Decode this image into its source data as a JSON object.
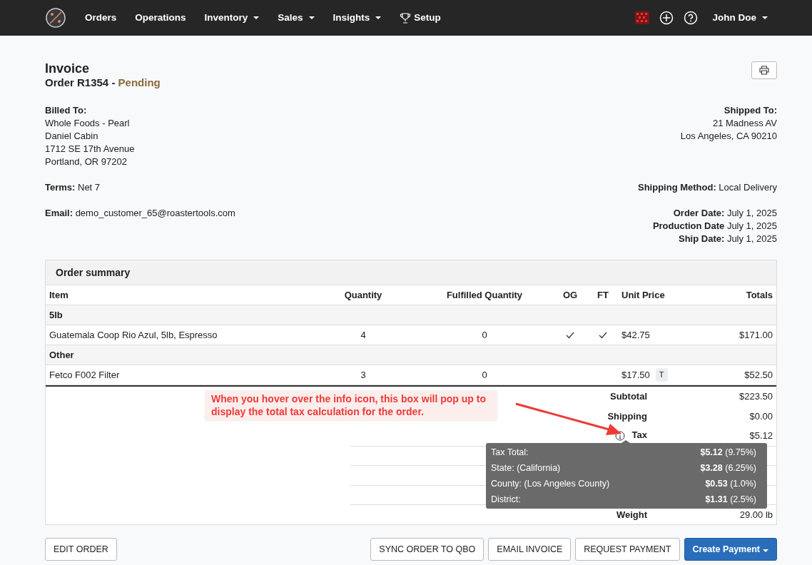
{
  "nav": {
    "items": [
      {
        "label": "Orders",
        "dropdown": false,
        "kind": "link"
      },
      {
        "label": "Operations",
        "dropdown": false,
        "kind": "link"
      },
      {
        "label": "Inventory",
        "dropdown": true,
        "kind": "link"
      },
      {
        "label": "Sales",
        "dropdown": true,
        "kind": "link"
      },
      {
        "label": "Insights",
        "dropdown": true,
        "kind": "link"
      },
      {
        "label": "Setup",
        "dropdown": false,
        "kind": "icon-link"
      }
    ],
    "user": {
      "label": "John Doe",
      "dropdown": true
    }
  },
  "invoice": {
    "title": "Invoice",
    "order": "Order R1354 - ",
    "status": "Pending"
  },
  "billed_to": {
    "heading": "Billed To:",
    "lines": [
      "Whole Foods - Pearl",
      "Daniel Cabin",
      "1712 SE 17th Avenue",
      "Portland, OR 97202"
    ]
  },
  "shipped_to": {
    "heading": "Shipped To:",
    "lines": [
      "21 Madness AV",
      "Los Angeles, CA 90210"
    ]
  },
  "terms": {
    "label": "Terms:",
    "value": "Net 7"
  },
  "shipping_method": {
    "label": "Shipping Method:",
    "value": "Local Delivery"
  },
  "email": {
    "label": "Email:",
    "value": "demo_customer_65@roastertools.com"
  },
  "dates": [
    {
      "label": "Order Date:",
      "value": "July 1, 2025"
    },
    {
      "label": "Production Date",
      "value": "July 1, 2025"
    },
    {
      "label": "Ship Date:",
      "value": "July 1, 2025"
    }
  ],
  "summary": {
    "title": "Order summary",
    "columns": [
      "Item",
      "Quantity",
      "Fulfilled Quantity",
      "OG",
      "FT",
      "Unit Price",
      "Totals"
    ],
    "groups": [
      {
        "name": "5lb",
        "rows": [
          {
            "item": "Guatemala Coop Rio Azul, 5lb, Espresso",
            "quantity": "4",
            "fulfilled": "0",
            "og": true,
            "ft": true,
            "unit_price": "$42.75",
            "taxable": false,
            "total": "$171.00"
          }
        ]
      },
      {
        "name": "Other",
        "rows": [
          {
            "item": "Fetco F002 Filter",
            "quantity": "3",
            "fulfilled": "0",
            "og": false,
            "ft": false,
            "unit_price": "$17.50",
            "taxable": true,
            "tax_badge": "T",
            "total": "$52.50"
          }
        ]
      }
    ]
  },
  "totals": [
    {
      "label": "Subtotal",
      "value": "$223.50",
      "info": false
    },
    {
      "label": "Shipping",
      "value": "$0.00",
      "info": false
    },
    {
      "label": "Tax",
      "value": "$5.12",
      "info": true
    },
    {
      "label": "Weight",
      "value": "29.00 lb",
      "info": false
    }
  ],
  "tax_tooltip": [
    {
      "label": "Tax Total:",
      "amount": "$5.12",
      "percent": " (9.75%)"
    },
    {
      "label": "State: (California)",
      "amount": "$3.28",
      "percent": " (6.25%)"
    },
    {
      "label": "County: (Los Angeles County)",
      "amount": "$0.53",
      "percent": " (1.0%)"
    },
    {
      "label": "District:",
      "amount": "$1.31",
      "percent": " (2.5%)"
    }
  ],
  "callout": "When you hover over the info icon, this box will pop up to display the total tax calculation for the order.",
  "buttons_left": [
    "EDIT ORDER"
  ],
  "buttons_right": [
    "SYNC ORDER TO QBO",
    "EMAIL INVOICE",
    "REQUEST PAYMENT"
  ],
  "primary_button": {
    "label": "Create Payment",
    "dropdown": true
  }
}
